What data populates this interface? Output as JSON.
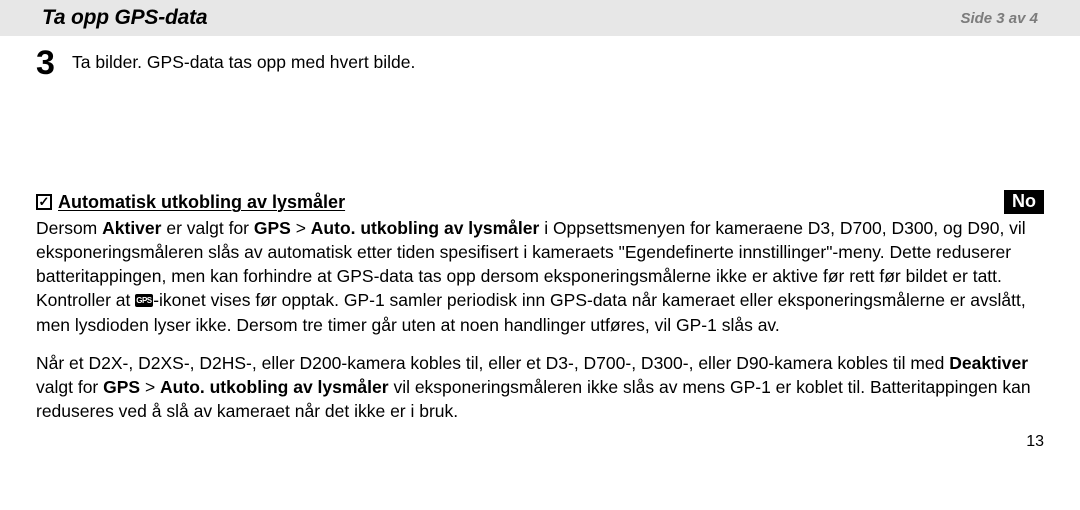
{
  "header": {
    "title": "Ta opp GPS-data",
    "side": "Side 3 av 4"
  },
  "step": {
    "num": "3",
    "text": "Ta bilder. GPS-data tas opp med hvert bilde."
  },
  "subhead": "Automatisk utkobling av lysmåler",
  "lang_badge": "No",
  "p1_a": "Dersom ",
  "p1_b1": "Aktiver",
  "p1_c": " er valgt for ",
  "p1_b2": "GPS",
  "p1_d": " > ",
  "p1_b3": "Auto. utkobling av lysmåler",
  "p1_e": " i Oppsettsmenyen for kameraene D3, D700, D300, og D90, vil eksponeringsmåleren slås av automatisk etter tiden spesifisert i kameraets \"Egendefinerte innstillinger\"-meny. Dette reduserer batteritappingen, men kan forhindre at GPS-data tas opp dersom eksponeringsmålerne ikke er aktive før rett før bildet er tatt. Kontroller at ",
  "p1_f": "-ikonet vises før opptak. GP-1 samler periodisk inn GPS-data når kameraet eller eksponeringsmålerne er avslått, men lysdioden lyser ikke. Dersom tre timer går uten at noen handlinger utføres, vil GP-1 slås av.",
  "p2_a": "Når et D2X-, D2XS-, D2HS-, eller D200-kamera kobles til, eller et D3-, D700-, D300-, eller D90-kamera kobles til med ",
  "p2_b1": "Deaktiver",
  "p2_c": " valgt for ",
  "p2_b2": "GPS",
  "p2_d": " > ",
  "p2_b3": "Auto. utkobling av lysmåler",
  "p2_e": " vil eksponeringsmåleren ikke slås av mens GP-1 er koblet til. Batteritappingen kan reduseres ved å slå av kameraet når det ikke er i bruk.",
  "pagenum": "13"
}
